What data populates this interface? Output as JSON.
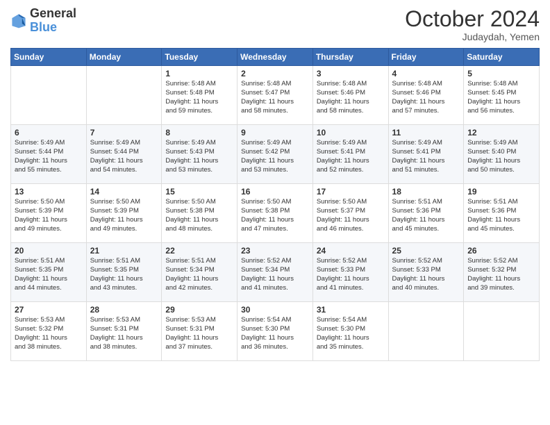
{
  "logo": {
    "line1": "General",
    "line2": "Blue"
  },
  "title": "October 2024",
  "subtitle": "Judaydah, Yemen",
  "weekdays": [
    "Sunday",
    "Monday",
    "Tuesday",
    "Wednesday",
    "Thursday",
    "Friday",
    "Saturday"
  ],
  "weeks": [
    [
      {
        "day": "",
        "info": ""
      },
      {
        "day": "",
        "info": ""
      },
      {
        "day": "1",
        "info": "Sunrise: 5:48 AM\nSunset: 5:48 PM\nDaylight: 11 hours\nand 59 minutes."
      },
      {
        "day": "2",
        "info": "Sunrise: 5:48 AM\nSunset: 5:47 PM\nDaylight: 11 hours\nand 58 minutes."
      },
      {
        "day": "3",
        "info": "Sunrise: 5:48 AM\nSunset: 5:46 PM\nDaylight: 11 hours\nand 58 minutes."
      },
      {
        "day": "4",
        "info": "Sunrise: 5:48 AM\nSunset: 5:46 PM\nDaylight: 11 hours\nand 57 minutes."
      },
      {
        "day": "5",
        "info": "Sunrise: 5:48 AM\nSunset: 5:45 PM\nDaylight: 11 hours\nand 56 minutes."
      }
    ],
    [
      {
        "day": "6",
        "info": "Sunrise: 5:49 AM\nSunset: 5:44 PM\nDaylight: 11 hours\nand 55 minutes."
      },
      {
        "day": "7",
        "info": "Sunrise: 5:49 AM\nSunset: 5:44 PM\nDaylight: 11 hours\nand 54 minutes."
      },
      {
        "day": "8",
        "info": "Sunrise: 5:49 AM\nSunset: 5:43 PM\nDaylight: 11 hours\nand 53 minutes."
      },
      {
        "day": "9",
        "info": "Sunrise: 5:49 AM\nSunset: 5:42 PM\nDaylight: 11 hours\nand 53 minutes."
      },
      {
        "day": "10",
        "info": "Sunrise: 5:49 AM\nSunset: 5:41 PM\nDaylight: 11 hours\nand 52 minutes."
      },
      {
        "day": "11",
        "info": "Sunrise: 5:49 AM\nSunset: 5:41 PM\nDaylight: 11 hours\nand 51 minutes."
      },
      {
        "day": "12",
        "info": "Sunrise: 5:49 AM\nSunset: 5:40 PM\nDaylight: 11 hours\nand 50 minutes."
      }
    ],
    [
      {
        "day": "13",
        "info": "Sunrise: 5:50 AM\nSunset: 5:39 PM\nDaylight: 11 hours\nand 49 minutes."
      },
      {
        "day": "14",
        "info": "Sunrise: 5:50 AM\nSunset: 5:39 PM\nDaylight: 11 hours\nand 49 minutes."
      },
      {
        "day": "15",
        "info": "Sunrise: 5:50 AM\nSunset: 5:38 PM\nDaylight: 11 hours\nand 48 minutes."
      },
      {
        "day": "16",
        "info": "Sunrise: 5:50 AM\nSunset: 5:38 PM\nDaylight: 11 hours\nand 47 minutes."
      },
      {
        "day": "17",
        "info": "Sunrise: 5:50 AM\nSunset: 5:37 PM\nDaylight: 11 hours\nand 46 minutes."
      },
      {
        "day": "18",
        "info": "Sunrise: 5:51 AM\nSunset: 5:36 PM\nDaylight: 11 hours\nand 45 minutes."
      },
      {
        "day": "19",
        "info": "Sunrise: 5:51 AM\nSunset: 5:36 PM\nDaylight: 11 hours\nand 45 minutes."
      }
    ],
    [
      {
        "day": "20",
        "info": "Sunrise: 5:51 AM\nSunset: 5:35 PM\nDaylight: 11 hours\nand 44 minutes."
      },
      {
        "day": "21",
        "info": "Sunrise: 5:51 AM\nSunset: 5:35 PM\nDaylight: 11 hours\nand 43 minutes."
      },
      {
        "day": "22",
        "info": "Sunrise: 5:51 AM\nSunset: 5:34 PM\nDaylight: 11 hours\nand 42 minutes."
      },
      {
        "day": "23",
        "info": "Sunrise: 5:52 AM\nSunset: 5:34 PM\nDaylight: 11 hours\nand 41 minutes."
      },
      {
        "day": "24",
        "info": "Sunrise: 5:52 AM\nSunset: 5:33 PM\nDaylight: 11 hours\nand 41 minutes."
      },
      {
        "day": "25",
        "info": "Sunrise: 5:52 AM\nSunset: 5:33 PM\nDaylight: 11 hours\nand 40 minutes."
      },
      {
        "day": "26",
        "info": "Sunrise: 5:52 AM\nSunset: 5:32 PM\nDaylight: 11 hours\nand 39 minutes."
      }
    ],
    [
      {
        "day": "27",
        "info": "Sunrise: 5:53 AM\nSunset: 5:32 PM\nDaylight: 11 hours\nand 38 minutes."
      },
      {
        "day": "28",
        "info": "Sunrise: 5:53 AM\nSunset: 5:31 PM\nDaylight: 11 hours\nand 38 minutes."
      },
      {
        "day": "29",
        "info": "Sunrise: 5:53 AM\nSunset: 5:31 PM\nDaylight: 11 hours\nand 37 minutes."
      },
      {
        "day": "30",
        "info": "Sunrise: 5:54 AM\nSunset: 5:30 PM\nDaylight: 11 hours\nand 36 minutes."
      },
      {
        "day": "31",
        "info": "Sunrise: 5:54 AM\nSunset: 5:30 PM\nDaylight: 11 hours\nand 35 minutes."
      },
      {
        "day": "",
        "info": ""
      },
      {
        "day": "",
        "info": ""
      }
    ]
  ]
}
